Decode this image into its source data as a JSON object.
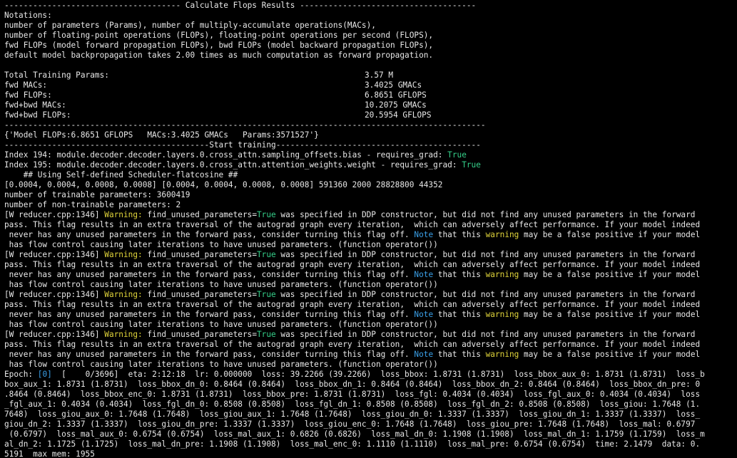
{
  "colors": {
    "background": "#000000",
    "text": "#e8e8e8",
    "true": "#35d08a",
    "warning": "#e0d43a",
    "note": "#3aa0e8"
  },
  "header": "------------------------------------- Calculate Flops Results -------------------------------------",
  "notations": [
    "Notations:",
    "number of parameters (Params), number of multiply-accumulate operations(MACs),",
    "number of floating-point operations (FLOPs), floating-point operations per second (FLOPS),",
    "fwd FLOPs (model forward propagation FLOPs), bwd FLOPs (model backward propagation FLOPs),",
    "default model backpropagation takes 2.00 times as much computation as forward propagation."
  ],
  "stats": [
    {
      "label": "Total Training Params:",
      "value": "3.57 M"
    },
    {
      "label": "fwd MACs:",
      "value": "3.4025 GMACs"
    },
    {
      "label": "fwd FLOPs:",
      "value": "6.8651 GFLOPS"
    },
    {
      "label": "fwd+bwd MACs:",
      "value": "10.2075 GMACs"
    },
    {
      "label": "fwd+bwd FLOPs:",
      "value": "20.5954 GFLOPS"
    }
  ],
  "separator": "-----------------------------------------------------------------------------------------------------",
  "summary": "{'Model FLOPs:6.8651 GFLOPS   MACs:3.4025 GMACs   Params:3571527'}",
  "start_training": "-------------------------------------------Start training-------------------------------------------",
  "index_lines": [
    {
      "text": "Index 194: module.decoder.decoder.layers.0.cross_attn.sampling_offsets.bias - requires_grad: ",
      "flag": "True"
    },
    {
      "text": "Index 195: module.decoder.decoder.layers.0.cross_attn.attention_weights.weight - requires_grad: ",
      "flag": "True"
    }
  ],
  "scheduler": "    ## Using Self-defined Scheduler-flatcosine ##",
  "lr_line": "[0.0004, 0.0004, 0.0008, 0.0008] [0.0004, 0.0004, 0.0008, 0.0008] 591360 2000 28828800 44352",
  "trainable": "number of trainable parameters: 3600419",
  "non_trainable": "number of non-trainable parameters: 2",
  "warning_block": {
    "prefix": "[W reducer.cpp:1346] ",
    "warning_word": "Warning:",
    "mid1": " find_unused_parameters=",
    "true_word": "True",
    "rest1": " was specified in DDP constructor, but did not find any unused parameters in the forward",
    "line2": "pass. This flag results in an extra traversal of the autograd graph every iteration,  which can adversely affect performance. If your model indeed",
    "line3_a": " never has any unused parameters in the forward pass, consider turning this flag off. ",
    "note_word": "Note",
    "line3_b": " that this ",
    "warning_lower": "warning",
    "line3_c": " may be a false positive if your model",
    "line4": " has flow control causing later iterations to have unused parameters. (function operator())"
  },
  "epoch": {
    "label_a": "Epoch: ",
    "epoch_num": "[0]",
    "label_b": "  [    0/3696]  eta: 2:12:18  lr: 0.000000  loss: 39.2266 (39.2266)  loss_bbox: 1.8731 (1.8731)  loss_bbox_aux_0: 1.8731 (1.8731)  loss_b",
    "lines": [
      "box_aux_1: 1.8731 (1.8731)  loss_bbox_dn_0: 0.8464 (0.8464)  loss_bbox_dn_1: 0.8464 (0.8464)  loss_bbox_dn_2: 0.8464 (0.8464)  loss_bbox_dn_pre: 0",
      ".8464 (0.8464)  loss_bbox_enc_0: 1.8731 (1.8731)  loss_bbox_pre: 1.8731 (1.8731)  loss_fgl: 0.4034 (0.4034)  loss_fgl_aux_0: 0.4034 (0.4034)  loss",
      "_fgl_aux_1: 0.4034 (0.4034)  loss_fgl_dn_0: 0.8508 (0.8508)  loss_fgl_dn_1: 0.8508 (0.8508)  loss_fgl_dn_2: 0.8508 (0.8508)  loss_giou: 1.7648 (1.",
      "7648)  loss_giou_aux_0: 1.7648 (1.7648)  loss_giou_aux_1: 1.7648 (1.7648)  loss_giou_dn_0: 1.3337 (1.3337)  loss_giou_dn_1: 1.3337 (1.3337)  loss_",
      "giou_dn_2: 1.3337 (1.3337)  loss_giou_dn_pre: 1.3337 (1.3337)  loss_giou_enc_0: 1.7648 (1.7648)  loss_giou_pre: 1.7648 (1.7648)  loss_mal: 0.6797",
      " (0.6797)  loss_mal_aux_0: 0.6754 (0.6754)  loss_mal_aux_1: 0.6826 (0.6826)  loss_mal_dn_0: 1.1908 (1.1908)  loss_mal_dn_1: 1.1759 (1.1759)  loss_m",
      "al_dn_2: 1.1725 (1.1725)  loss_mal_dn_pre: 1.1908 (1.1908)  loss_mal_enc_0: 1.1110 (1.1110)  loss_mal_pre: 0.6754 (0.6754)  time: 2.1479  data: 0.",
      "5191  max mem: 1955"
    ]
  }
}
